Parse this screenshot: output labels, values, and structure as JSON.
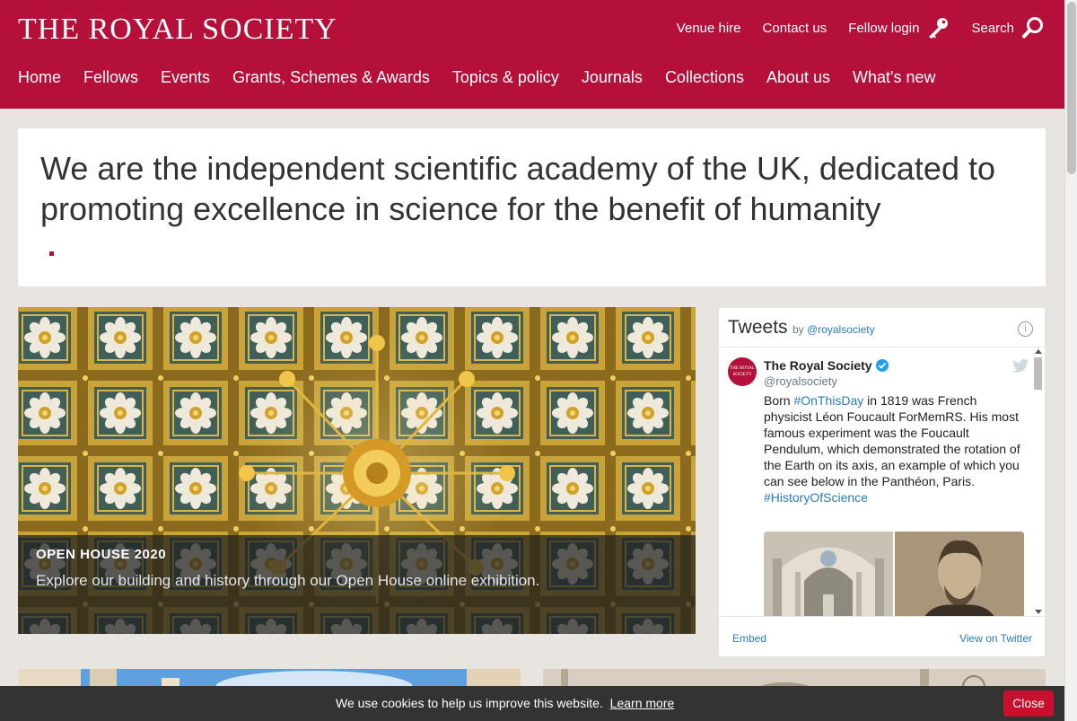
{
  "header": {
    "logo": "THE ROYAL SOCIETY",
    "utility": {
      "venue_hire": "Venue hire",
      "contact_us": "Contact us",
      "fellow_login": "Fellow login",
      "search": "Search"
    },
    "nav": [
      {
        "label": "Home"
      },
      {
        "label": "Fellows"
      },
      {
        "label": "Events"
      },
      {
        "label": "Grants, Schemes & Awards"
      },
      {
        "label": "Topics & policy"
      },
      {
        "label": "Journals"
      },
      {
        "label": "Collections"
      },
      {
        "label": "About us"
      },
      {
        "label": "What's new"
      }
    ],
    "brand_color": "#b5103a"
  },
  "intro": {
    "mission": "We are the independent scientific academy of the UK, dedicated to promoting excellence in science for the benefit of humanity"
  },
  "hero": {
    "title": "OPEN HOUSE 2020",
    "description": "Explore our building and history through our Open House online exhibition."
  },
  "tweets": {
    "title": "Tweets",
    "by": "by",
    "handle_link": "@royalsociety",
    "tweet": {
      "avatar_text": "THE ROYAL SOCIETY",
      "name": "The Royal Society",
      "handle": "@royalsociety",
      "text_1": "Born ",
      "hashtag_1": "#OnThisDay",
      "text_2": " in 1819 was French physicist Léon Foucault ForMemRS. His most famous experiment was the Foucault Pendulum, which demonstrated the rotation of the Earth on its axis, an example of which you can see below in the Panthéon, Paris.",
      "hashtag_2": "#HistoryOfScience"
    },
    "embed": "Embed",
    "view_on_twitter": "View on Twitter",
    "link_color": "#2b7bb9"
  },
  "cookie": {
    "message": "We use cookies to help us improve this website.",
    "learn_more": "Learn more",
    "close": "Close"
  }
}
